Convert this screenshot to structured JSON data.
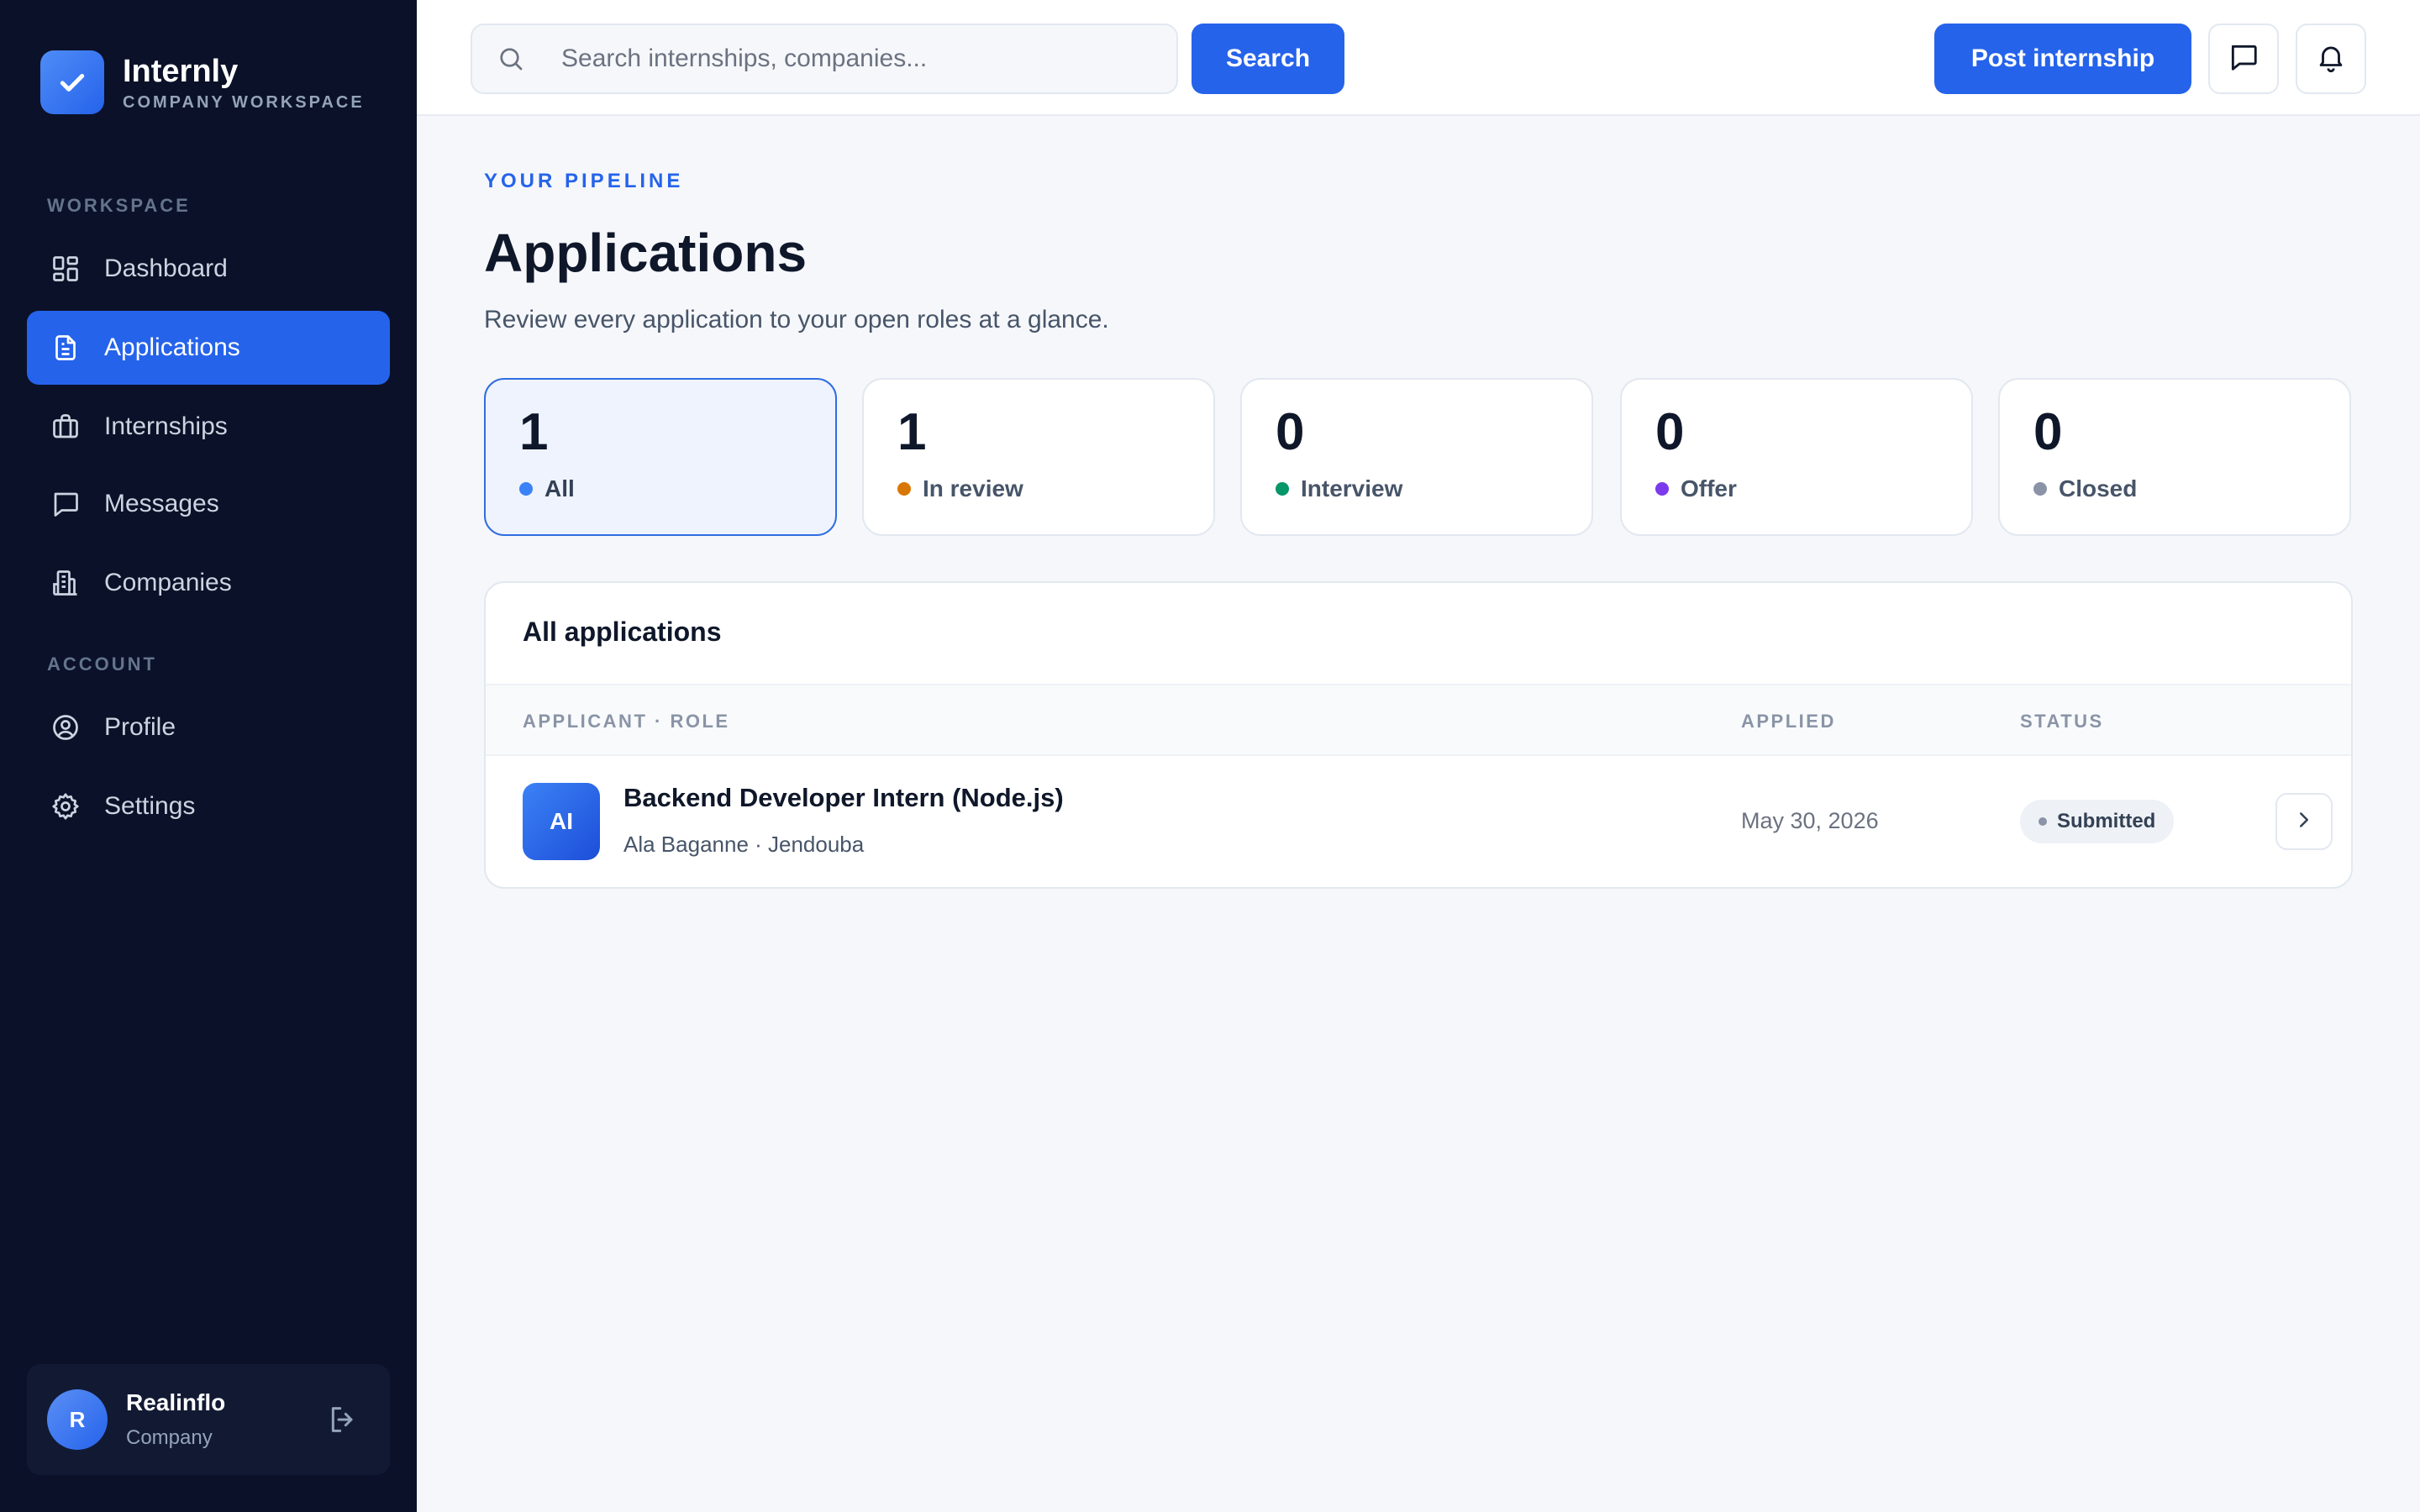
{
  "brand": {
    "name": "Internly",
    "subtitle": "COMPANY WORKSPACE"
  },
  "sidebar": {
    "workspace_label": "WORKSPACE",
    "account_label": "ACCOUNT",
    "items": [
      {
        "label": "Dashboard",
        "icon": "grid-icon",
        "active": false
      },
      {
        "label": "Applications",
        "icon": "document-icon",
        "active": true
      },
      {
        "label": "Internships",
        "icon": "briefcase-icon",
        "active": false
      },
      {
        "label": "Messages",
        "icon": "chat-icon",
        "active": false
      },
      {
        "label": "Companies",
        "icon": "building-icon",
        "active": false
      },
      {
        "label": "Profile",
        "icon": "user-circle-icon",
        "active": false
      },
      {
        "label": "Settings",
        "icon": "gear-icon",
        "active": false
      }
    ]
  },
  "user": {
    "initial": "R",
    "name": "Realinflo",
    "role": "Company"
  },
  "topbar": {
    "search_placeholder": "Search internships, companies...",
    "search_button": "Search",
    "post_button": "Post internship"
  },
  "page": {
    "eyebrow": "YOUR PIPELINE",
    "title": "Applications",
    "description": "Review every application to your open roles at a glance."
  },
  "stats": [
    {
      "count": "1",
      "label": "All",
      "color": "#3b82f6",
      "active": true
    },
    {
      "count": "1",
      "label": "In review",
      "color": "#d97706",
      "active": false
    },
    {
      "count": "0",
      "label": "Interview",
      "color": "#059669",
      "active": false
    },
    {
      "count": "0",
      "label": "Offer",
      "color": "#7c3aed",
      "active": false
    },
    {
      "count": "0",
      "label": "Closed",
      "color": "#8a94a6",
      "active": false
    }
  ],
  "table": {
    "title": "All applications",
    "columns": [
      "APPLICANT · ROLE",
      "APPLIED",
      "STATUS"
    ],
    "rows": [
      {
        "initials": "AI",
        "role": "Backend Developer Intern (Node.js)",
        "applicant": "Ala Baganne · Jendouba",
        "applied": "May 30, 2026",
        "status": "Submitted"
      }
    ]
  },
  "colors": {
    "accent": "#2563eb",
    "sidebar_bg": "#0a1128",
    "page_bg": "#f6f7fa"
  }
}
